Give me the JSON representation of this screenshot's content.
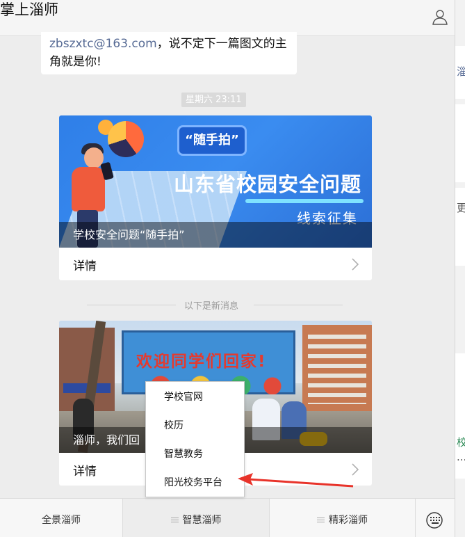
{
  "header": {
    "title": "掌上淄师",
    "user_icon": "user-icon"
  },
  "bubble": {
    "email": "zbszxtc@163.com",
    "text_after_email": "，说不定下一篇图文的主",
    "line2": "角就是你!"
  },
  "timestamp": "星期六 23:11",
  "card1": {
    "badge": "“随手拍”",
    "title": "山东省校园安全问题",
    "subtitle": "线索征集",
    "caption": "学校安全问题“随手拍”",
    "detail_label": "详情"
  },
  "divider": "以下是新消息",
  "card2": {
    "banner": "欢迎同学们回家!",
    "caption": "淄师，我们回",
    "detail_label": "详情"
  },
  "submenu": {
    "items": [
      "学校官网",
      "校历",
      "智慧教务",
      "阳光校务平台"
    ]
  },
  "menubar": {
    "items": [
      "全景淄师",
      "智慧淄师",
      "精彩淄师"
    ],
    "keyboard_icon": "keyboard-icon"
  },
  "background_window": {
    "fragments": [
      "淄",
      "更",
      "校",
      "..."
    ],
    "fragment_colors": [
      "#576b95",
      "#555555",
      "#2e8b57",
      "#555555"
    ]
  },
  "annotation": {
    "arrow_color": "#e8332a"
  }
}
